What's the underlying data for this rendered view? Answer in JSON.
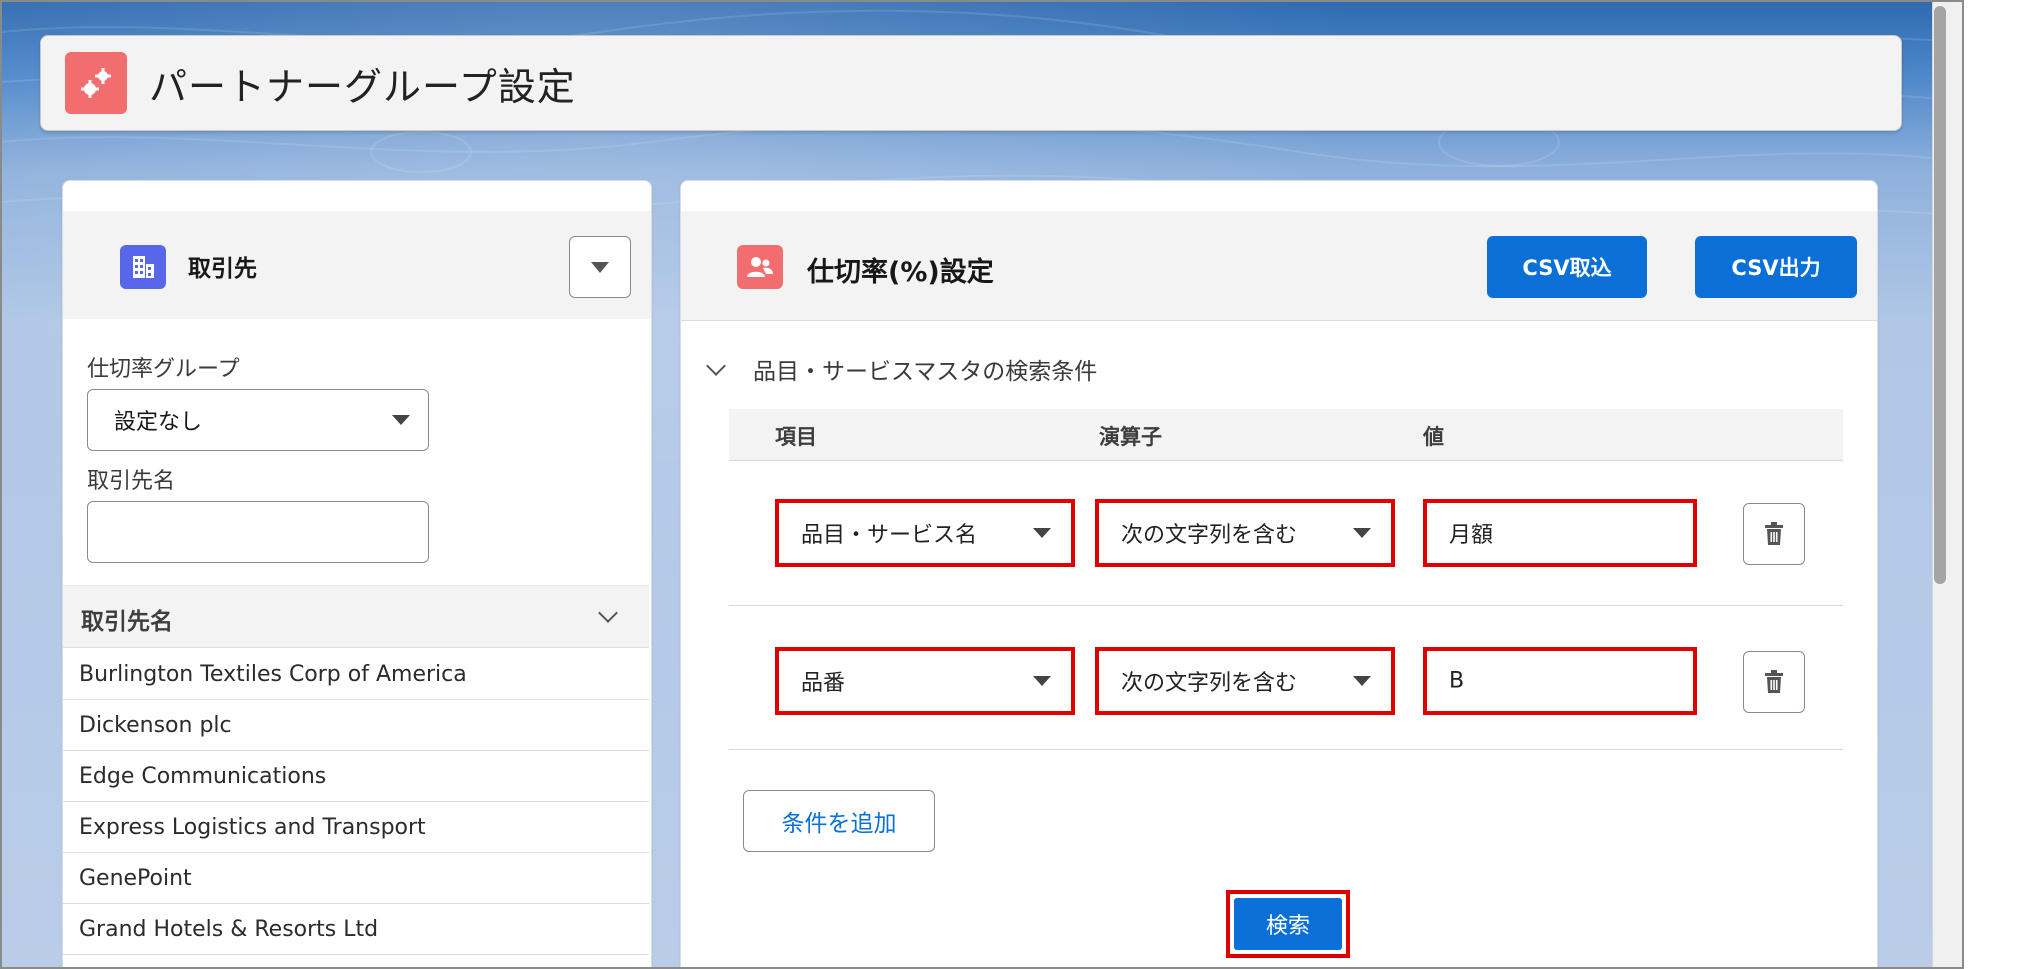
{
  "header": {
    "title": "パートナーグループ設定",
    "icon": "gears-icon"
  },
  "left_panel": {
    "title": "取引先",
    "icon": "building-icon",
    "group_label": "仕切率グループ",
    "group_select_value": "設定なし",
    "name_label": "取引先名",
    "name_input_value": "",
    "list_header": "取引先名",
    "accounts": [
      "Burlington Textiles Corp of America",
      "Dickenson plc",
      "Edge Communications",
      "Express Logistics and Transport",
      "GenePoint",
      "Grand Hotels & Resorts Ltd"
    ]
  },
  "right_panel": {
    "title": "仕切率(%)設定",
    "icon": "partner-icon",
    "csv_import": "CSV取込",
    "csv_export": "CSV出力",
    "section_title": "品目・サービスマスタの検索条件",
    "columns": [
      "項目",
      "演算子",
      "値"
    ],
    "conditions": [
      {
        "field": "品目・サービス名",
        "operator": "次の文字列を含む",
        "value": "月額"
      },
      {
        "field": "品番",
        "operator": "次の文字列を含む",
        "value": "B"
      }
    ],
    "add_condition": "条件を追加",
    "search": "検索"
  },
  "colors": {
    "brand": "#0a6fd6",
    "highlight": "#e10000",
    "header_icon": "#f26e6e",
    "account_icon": "#5867e8"
  }
}
